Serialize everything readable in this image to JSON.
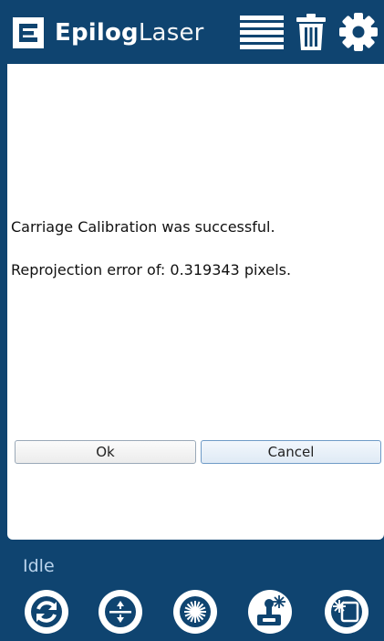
{
  "header": {
    "brand_bold": "Epilog",
    "brand_light": "Laser",
    "icons": [
      "epilog-logo-icon",
      "job-queue-icon",
      "trash-icon",
      "settings-gear-icon"
    ]
  },
  "dialog": {
    "message_line1": "Carriage Calibration was successful.",
    "message_line2": "Reprojection error of: 0.319343 pixels.",
    "ok_label": "Ok",
    "cancel_label": "Cancel"
  },
  "status": {
    "text": "Idle"
  },
  "toolbar": {
    "icons": [
      "refresh-icon",
      "focus-icon",
      "laser-fire-icon",
      "joystick-laser-icon",
      "frame-laser-icon"
    ]
  },
  "colors": {
    "primary": "#0f4470",
    "surface": "#ffffff",
    "status_text": "#b9d3ec"
  }
}
